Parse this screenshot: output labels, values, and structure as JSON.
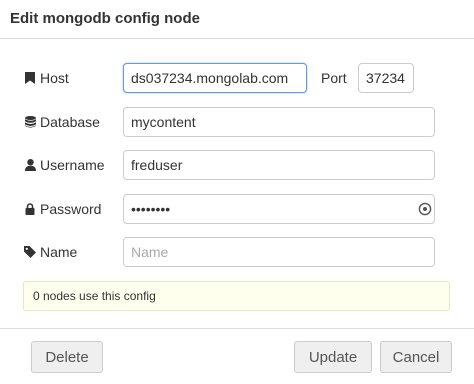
{
  "dialog": {
    "title": "Edit mongodb config node"
  },
  "fields": {
    "host": {
      "label": "Host",
      "value": "ds037234.mongolab.com",
      "icon": "bookmark-icon"
    },
    "port": {
      "label": "Port",
      "value": "37234"
    },
    "database": {
      "label": "Database",
      "value": "mycontent",
      "icon": "database-icon"
    },
    "username": {
      "label": "Username",
      "value": "freduser",
      "icon": "user-icon"
    },
    "password": {
      "label": "Password",
      "value": "••••••••",
      "icon": "lock-icon"
    },
    "name": {
      "label": "Name",
      "value": "",
      "placeholder": "Name",
      "icon": "tag-icon"
    }
  },
  "info": {
    "text": "0 nodes use this config"
  },
  "footer": {
    "delete_label": "Delete",
    "update_label": "Update",
    "cancel_label": "Cancel"
  },
  "colors": {
    "focus_border": "#6e98d4",
    "info_bg": "#ffffee",
    "button_bg": "#efefef"
  }
}
